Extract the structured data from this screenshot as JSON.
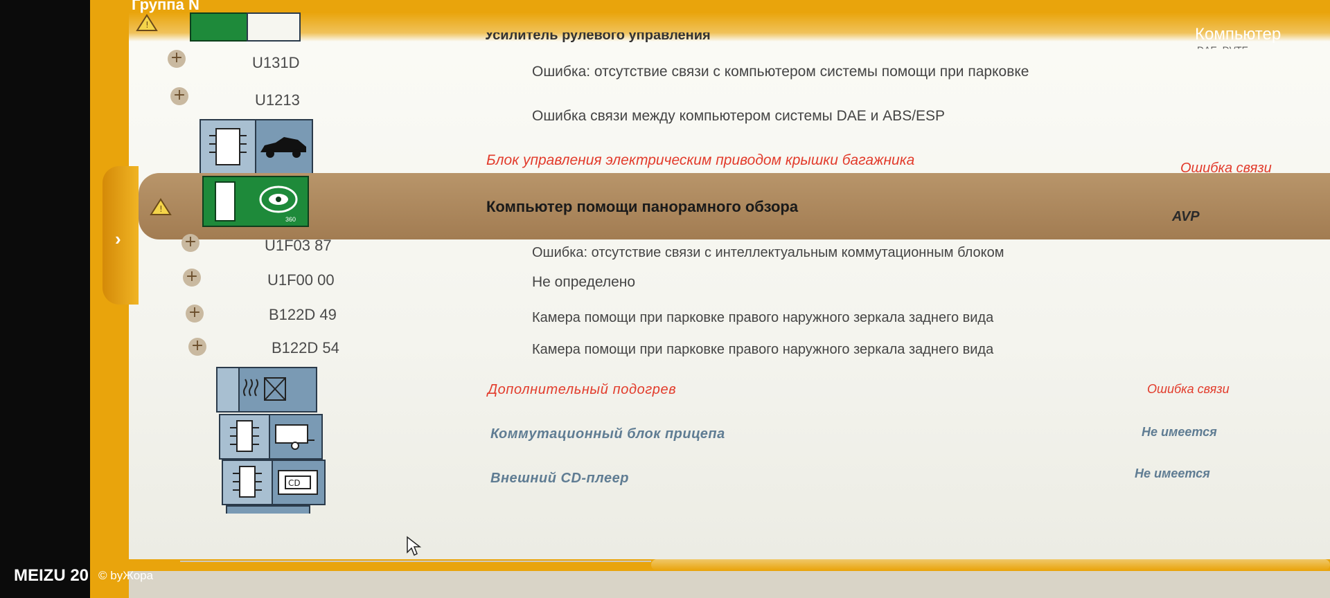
{
  "window": {
    "title": "Группа N",
    "header_right": "Компьютер"
  },
  "header_row": {
    "title": "Усилитель рулевого управления",
    "extra": "DAE_DVTE"
  },
  "fault_rows_top": [
    {
      "code": "U131D",
      "desc": "Ошибка: отсутствие связи с компьютером системы помощи при парковке"
    },
    {
      "code": "U1213",
      "desc": "Ошибка связи между компьютером системы DAE и ABS/ESP"
    }
  ],
  "units_mid": [
    {
      "name": "Блок управления электрическим приводом крышки багажника",
      "status": "Ошибка связи"
    }
  ],
  "selected_unit": {
    "name": "Компьютер помощи панорамного обзора",
    "code": "AVP",
    "icon_label": "360"
  },
  "fault_rows_selected": [
    {
      "code": "U1F03 87",
      "desc": "Ошибка: отсутствие связи с интеллектуальным коммутационным блоком"
    },
    {
      "code": "U1F00 00",
      "desc": "Не определено"
    },
    {
      "code": "B122D 49",
      "desc": "Камера помощи при парковке правого наружного зеркала заднего вида"
    },
    {
      "code": "B122D 54",
      "desc": "Камера помощи при парковке правого наружного зеркала заднего вида"
    }
  ],
  "units_bottom": [
    {
      "name": "Дополнительный подогрев",
      "status": "Ошибка связи",
      "style": "red"
    },
    {
      "name": "Коммутационный блок прицепа",
      "status": "Не имеется",
      "style": "grey"
    },
    {
      "name": "Внешний CD-плеер",
      "status": "Не имеется",
      "style": "grey"
    }
  ],
  "watermark": {
    "brand": "MEIZU 20",
    "by": "© byЖора"
  },
  "colors": {
    "frame": "#e9a40c",
    "selected": "#a8845a",
    "error": "#e23b2b",
    "absent": "#5f7c93"
  },
  "icons": {
    "expand": "plus-icon",
    "warning": "warning-icon",
    "ecu": "ecu-chip-icon",
    "car": "car-icon",
    "camera": "360-camera-icon",
    "heater": "heater-icon",
    "trailer": "trailer-icon",
    "cd": "cd-player-icon"
  }
}
